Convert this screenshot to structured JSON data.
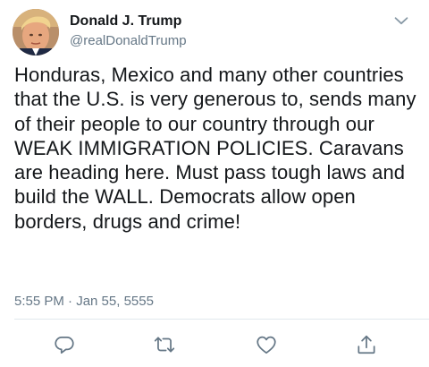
{
  "author": {
    "display_name": "Donald J. Trump",
    "handle": "@realDonaldTrump",
    "avatar_icon": "profile-photo"
  },
  "tweet": {
    "text": "Honduras, Mexico and many other countries that the U.S. is very generous to, sends many of their people to our country through our WEAK IMMIGRATION POLICIES. Caravans are heading here. Must pass tough laws and build the WALL. Democrats allow open borders, drugs and crime!",
    "timestamp": "5:55 PM · Jan 55, 5555"
  },
  "menu": {
    "icon": "chevron-down-icon"
  },
  "actions": [
    {
      "name": "reply",
      "icon": "reply-icon"
    },
    {
      "name": "retweet",
      "icon": "retweet-icon"
    },
    {
      "name": "like",
      "icon": "heart-icon"
    },
    {
      "name": "share",
      "icon": "share-icon"
    }
  ],
  "colors": {
    "text": "#14171a",
    "secondary": "#657786",
    "icon": "#657786",
    "divider": "#e1e8ed"
  }
}
